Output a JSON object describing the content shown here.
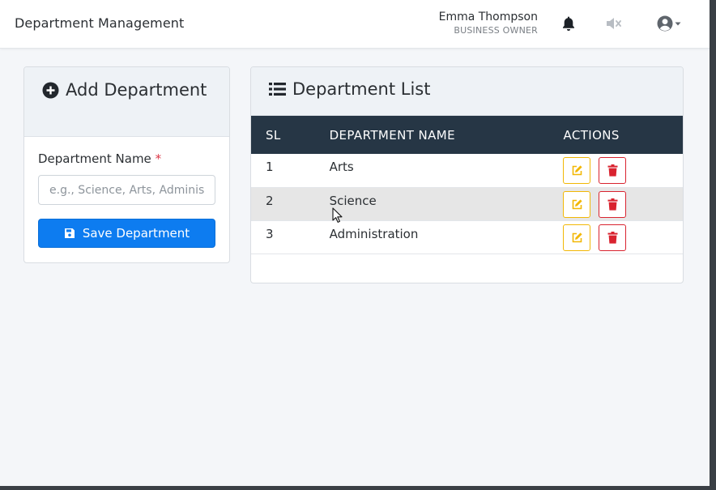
{
  "header": {
    "app_title": "Department Management",
    "user_name": "Emma Thompson",
    "user_role": "BUSINESS OWNER",
    "icons": [
      "bell-icon",
      "volume-mute-icon",
      "user-circle-icon",
      "caret-down-icon"
    ]
  },
  "add_card": {
    "title": "Add Department",
    "title_icon": "plus-circle-icon",
    "field_label": "Department Name",
    "required_mark": "*",
    "input_placeholder": "e.g., Science, Arts, Administration",
    "input_value": "",
    "save_label": "Save Department",
    "save_icon": "save-icon"
  },
  "list_card": {
    "title": "Department List",
    "title_icon": "list-icon",
    "columns": [
      "SL",
      "DEPARTMENT NAME",
      "ACTIONS"
    ],
    "rows": [
      {
        "sl": "1",
        "name": "Arts"
      },
      {
        "sl": "2",
        "name": "Science"
      },
      {
        "sl": "3",
        "name": "Administration"
      }
    ],
    "row_action_icons": [
      "edit-icon",
      "trash-icon"
    ]
  },
  "colors": {
    "primary": "#0d7cf0",
    "table_header": "#263645",
    "edit": "#f2b705",
    "delete": "#d9232f",
    "required": "#dc3545"
  }
}
